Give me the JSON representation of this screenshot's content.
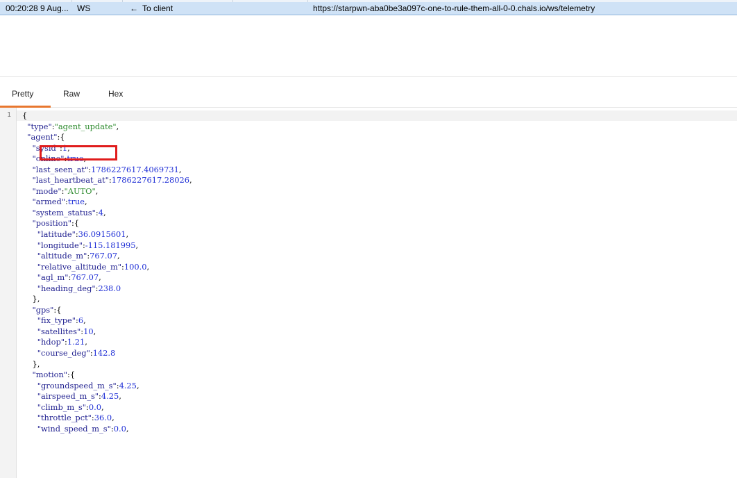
{
  "message_row": {
    "time": "00:20:28 9 Aug...",
    "type": "WS",
    "direction_arrow": "←",
    "direction": "To client",
    "url": "https://starpwn-aba0be3a097c-one-to-rule-them-all-0-0.chals.io/ws/telemetry"
  },
  "tabs": [
    {
      "label": "Pretty",
      "active": true
    },
    {
      "label": "Raw",
      "active": false
    },
    {
      "label": "Hex",
      "active": false
    }
  ],
  "viewer": {
    "line_number": "1",
    "lines": [
      [
        {
          "t": "p",
          "v": "{"
        }
      ],
      [
        {
          "t": "p",
          "v": "  "
        },
        {
          "t": "k",
          "v": "\"type\""
        },
        {
          "t": "p",
          "v": ":"
        },
        {
          "t": "s",
          "v": "\"agent_update\""
        },
        {
          "t": "p",
          "v": ","
        }
      ],
      [
        {
          "t": "p",
          "v": "  "
        },
        {
          "t": "k",
          "v": "\"agent\""
        },
        {
          "t": "p",
          "v": ":{"
        }
      ],
      [
        {
          "t": "p",
          "v": "    "
        },
        {
          "t": "k",
          "v": "\"sysid\""
        },
        {
          "t": "p",
          "v": ":"
        },
        {
          "t": "n",
          "v": "1"
        },
        {
          "t": "p",
          "v": ","
        }
      ],
      [
        {
          "t": "p",
          "v": "    "
        },
        {
          "t": "k",
          "v": "\"online\""
        },
        {
          "t": "p",
          "v": ":"
        },
        {
          "t": "n",
          "v": "true"
        },
        {
          "t": "p",
          "v": ","
        }
      ],
      [
        {
          "t": "p",
          "v": "    "
        },
        {
          "t": "k",
          "v": "\"last_seen_at\""
        },
        {
          "t": "p",
          "v": ":"
        },
        {
          "t": "n",
          "v": "1786227617.4069731"
        },
        {
          "t": "p",
          "v": ","
        }
      ],
      [
        {
          "t": "p",
          "v": "    "
        },
        {
          "t": "k",
          "v": "\"last_heartbeat_at\""
        },
        {
          "t": "p",
          "v": ":"
        },
        {
          "t": "n",
          "v": "1786227617.28026"
        },
        {
          "t": "p",
          "v": ","
        }
      ],
      [
        {
          "t": "p",
          "v": "    "
        },
        {
          "t": "k",
          "v": "\"mode\""
        },
        {
          "t": "p",
          "v": ":"
        },
        {
          "t": "s",
          "v": "\"AUTO\""
        },
        {
          "t": "p",
          "v": ","
        }
      ],
      [
        {
          "t": "p",
          "v": "    "
        },
        {
          "t": "k",
          "v": "\"armed\""
        },
        {
          "t": "p",
          "v": ":"
        },
        {
          "t": "n",
          "v": "true"
        },
        {
          "t": "p",
          "v": ","
        }
      ],
      [
        {
          "t": "p",
          "v": "    "
        },
        {
          "t": "k",
          "v": "\"system_status\""
        },
        {
          "t": "p",
          "v": ":"
        },
        {
          "t": "n",
          "v": "4"
        },
        {
          "t": "p",
          "v": ","
        }
      ],
      [
        {
          "t": "p",
          "v": "    "
        },
        {
          "t": "k",
          "v": "\"position\""
        },
        {
          "t": "p",
          "v": ":{"
        }
      ],
      [
        {
          "t": "p",
          "v": "      "
        },
        {
          "t": "k",
          "v": "\"latitude\""
        },
        {
          "t": "p",
          "v": ":"
        },
        {
          "t": "n",
          "v": "36.0915601"
        },
        {
          "t": "p",
          "v": ","
        }
      ],
      [
        {
          "t": "p",
          "v": "      "
        },
        {
          "t": "k",
          "v": "\"longitude\""
        },
        {
          "t": "p",
          "v": ":"
        },
        {
          "t": "n",
          "v": "-115.181995"
        },
        {
          "t": "p",
          "v": ","
        }
      ],
      [
        {
          "t": "p",
          "v": "      "
        },
        {
          "t": "k",
          "v": "\"altitude_m\""
        },
        {
          "t": "p",
          "v": ":"
        },
        {
          "t": "n",
          "v": "767.07"
        },
        {
          "t": "p",
          "v": ","
        }
      ],
      [
        {
          "t": "p",
          "v": "      "
        },
        {
          "t": "k",
          "v": "\"relative_altitude_m\""
        },
        {
          "t": "p",
          "v": ":"
        },
        {
          "t": "n",
          "v": "100.0"
        },
        {
          "t": "p",
          "v": ","
        }
      ],
      [
        {
          "t": "p",
          "v": "      "
        },
        {
          "t": "k",
          "v": "\"agl_m\""
        },
        {
          "t": "p",
          "v": ":"
        },
        {
          "t": "n",
          "v": "767.07"
        },
        {
          "t": "p",
          "v": ","
        }
      ],
      [
        {
          "t": "p",
          "v": "      "
        },
        {
          "t": "k",
          "v": "\"heading_deg\""
        },
        {
          "t": "p",
          "v": ":"
        },
        {
          "t": "n",
          "v": "238.0"
        }
      ],
      [
        {
          "t": "p",
          "v": "    },"
        }
      ],
      [
        {
          "t": "p",
          "v": "    "
        },
        {
          "t": "k",
          "v": "\"gps\""
        },
        {
          "t": "p",
          "v": ":{"
        }
      ],
      [
        {
          "t": "p",
          "v": "      "
        },
        {
          "t": "k",
          "v": "\"fix_type\""
        },
        {
          "t": "p",
          "v": ":"
        },
        {
          "t": "n",
          "v": "6"
        },
        {
          "t": "p",
          "v": ","
        }
      ],
      [
        {
          "t": "p",
          "v": "      "
        },
        {
          "t": "k",
          "v": "\"satellites\""
        },
        {
          "t": "p",
          "v": ":"
        },
        {
          "t": "n",
          "v": "10"
        },
        {
          "t": "p",
          "v": ","
        }
      ],
      [
        {
          "t": "p",
          "v": "      "
        },
        {
          "t": "k",
          "v": "\"hdop\""
        },
        {
          "t": "p",
          "v": ":"
        },
        {
          "t": "n",
          "v": "1.21"
        },
        {
          "t": "p",
          "v": ","
        }
      ],
      [
        {
          "t": "p",
          "v": "      "
        },
        {
          "t": "k",
          "v": "\"course_deg\""
        },
        {
          "t": "p",
          "v": ":"
        },
        {
          "t": "n",
          "v": "142.8"
        }
      ],
      [
        {
          "t": "p",
          "v": "    },"
        }
      ],
      [
        {
          "t": "p",
          "v": "    "
        },
        {
          "t": "k",
          "v": "\"motion\""
        },
        {
          "t": "p",
          "v": ":{"
        }
      ],
      [
        {
          "t": "p",
          "v": "      "
        },
        {
          "t": "k",
          "v": "\"groundspeed_m_s\""
        },
        {
          "t": "p",
          "v": ":"
        },
        {
          "t": "n",
          "v": "4.25"
        },
        {
          "t": "p",
          "v": ","
        }
      ],
      [
        {
          "t": "p",
          "v": "      "
        },
        {
          "t": "k",
          "v": "\"airspeed_m_s\""
        },
        {
          "t": "p",
          "v": ":"
        },
        {
          "t": "n",
          "v": "4.25"
        },
        {
          "t": "p",
          "v": ","
        }
      ],
      [
        {
          "t": "p",
          "v": "      "
        },
        {
          "t": "k",
          "v": "\"climb_m_s\""
        },
        {
          "t": "p",
          "v": ":"
        },
        {
          "t": "n",
          "v": "0.0"
        },
        {
          "t": "p",
          "v": ","
        }
      ],
      [
        {
          "t": "p",
          "v": "      "
        },
        {
          "t": "k",
          "v": "\"throttle_pct\""
        },
        {
          "t": "p",
          "v": ":"
        },
        {
          "t": "n",
          "v": "36.0"
        },
        {
          "t": "p",
          "v": ","
        }
      ],
      [
        {
          "t": "p",
          "v": "      "
        },
        {
          "t": "k",
          "v": "\"wind_speed_m_s\""
        },
        {
          "t": "p",
          "v": ":"
        },
        {
          "t": "n",
          "v": "0.0"
        },
        {
          "t": "p",
          "v": ","
        }
      ]
    ]
  },
  "colors": {
    "tab_active_underline": "#e8772e",
    "row_selected_background": "#cfe2f6",
    "annotation_box": "#e01c1c",
    "json_key": "#1f1f8f",
    "json_string": "#2e8b2e",
    "json_number": "#1f2fd6"
  }
}
